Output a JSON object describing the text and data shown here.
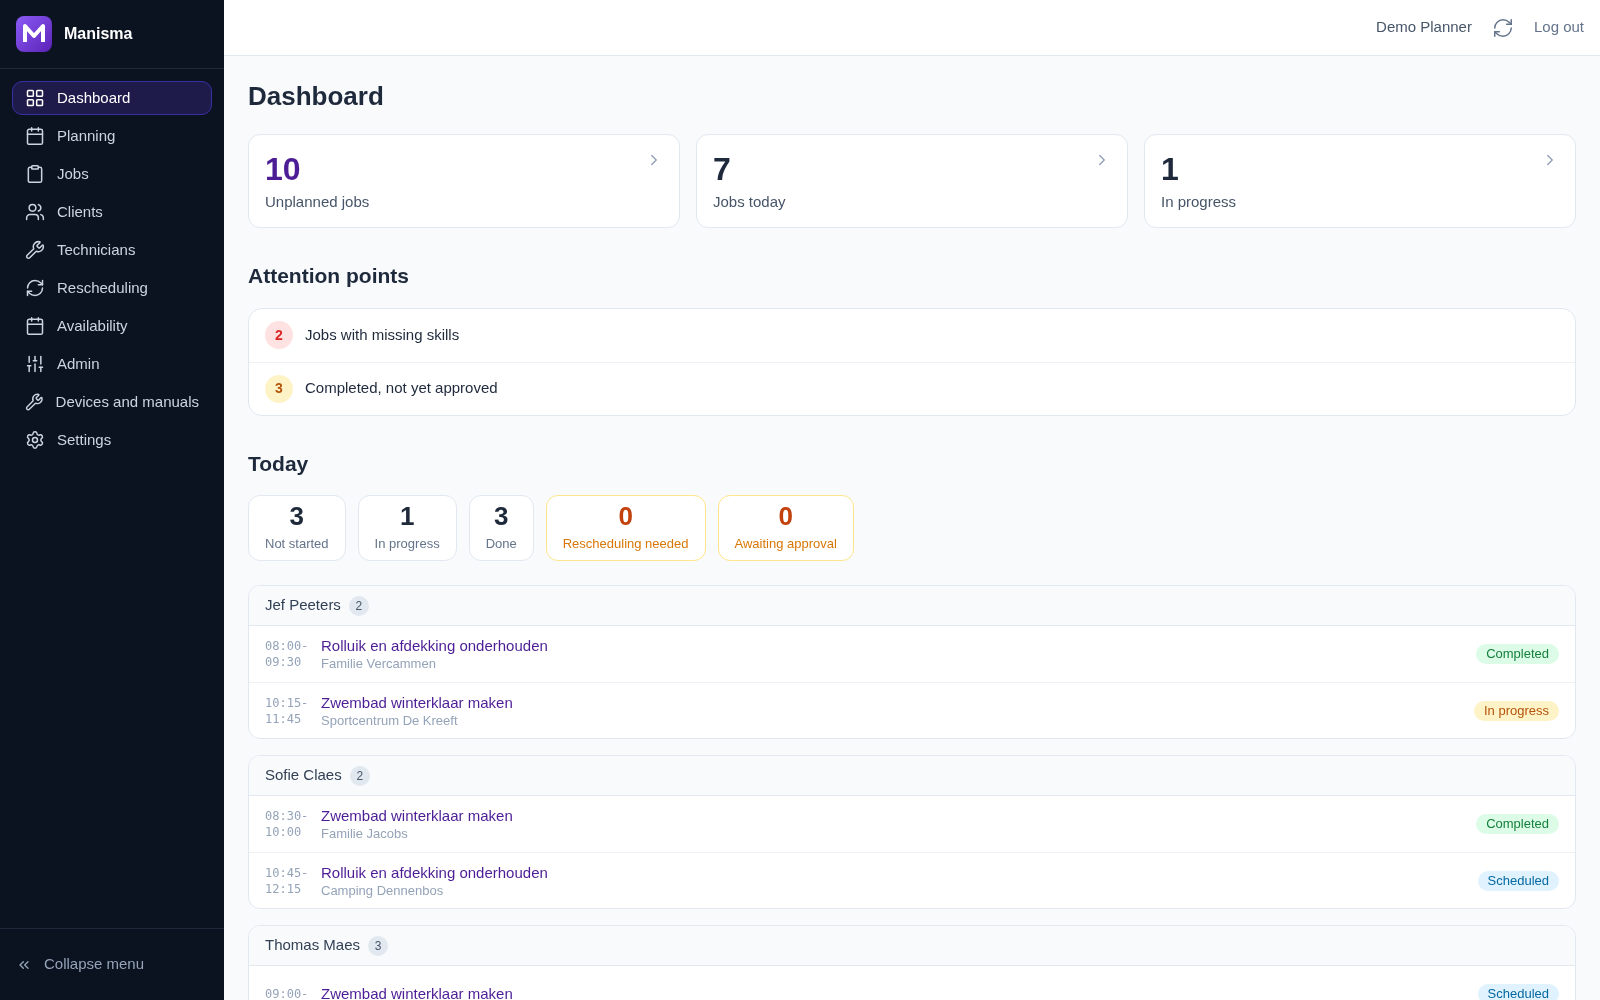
{
  "brand": {
    "name": "Manisma"
  },
  "sidebar": {
    "items": [
      {
        "label": "Dashboard",
        "selected": true
      },
      {
        "label": "Planning",
        "selected": false
      },
      {
        "label": "Jobs",
        "selected": false
      },
      {
        "label": "Clients",
        "selected": false
      },
      {
        "label": "Technicians",
        "selected": false
      },
      {
        "label": "Rescheduling",
        "selected": false
      },
      {
        "label": "Availability",
        "selected": false
      },
      {
        "label": "Admin",
        "selected": false
      },
      {
        "label": "Devices and manuals",
        "selected": false
      },
      {
        "label": "Settings",
        "selected": false
      }
    ],
    "collapse": "Collapse menu"
  },
  "topbar": {
    "user": "Demo Planner",
    "logout": "Log out"
  },
  "title": "Dashboard",
  "summary_cards": [
    {
      "value": "10",
      "label": "Unplanned jobs",
      "accent": true
    },
    {
      "value": "7",
      "label": "Jobs today",
      "accent": false
    },
    {
      "value": "1",
      "label": "In progress",
      "accent": false
    }
  ],
  "attention": {
    "title": "Attention points",
    "items": [
      {
        "count": "2",
        "label": "Jobs with missing skills",
        "kind": "danger"
      },
      {
        "count": "3",
        "label": "Completed, not yet approved",
        "kind": "warning"
      }
    ]
  },
  "today": {
    "title": "Today",
    "stats": [
      {
        "value": "3",
        "label": "Not started",
        "kind": "neutral"
      },
      {
        "value": "1",
        "label": "In progress",
        "kind": "neutral"
      },
      {
        "value": "3",
        "label": "Done",
        "kind": "neutral"
      },
      {
        "value": "0",
        "label": "Rescheduling needed",
        "kind": "warning"
      },
      {
        "value": "0",
        "label": "Awaiting approval",
        "kind": "warning"
      }
    ]
  },
  "technicians": [
    {
      "name": "Jef Peeters",
      "count": "2",
      "jobs": [
        {
          "start": "08:00-",
          "end": "09:30",
          "title": "Rolluik en afdekking onderhouden",
          "client": "Familie Vercammen",
          "status": "Completed",
          "kind": "completed"
        },
        {
          "start": "10:15-",
          "end": "11:45",
          "title": "Zwembad winterklaar maken",
          "client": "Sportcentrum De Kreeft",
          "status": "In progress",
          "kind": "in_progress"
        }
      ]
    },
    {
      "name": "Sofie Claes",
      "count": "2",
      "jobs": [
        {
          "start": "08:30-",
          "end": "10:00",
          "title": "Zwembad winterklaar maken",
          "client": "Familie Jacobs",
          "status": "Completed",
          "kind": "completed"
        },
        {
          "start": "10:45-",
          "end": "12:15",
          "title": "Rolluik en afdekking onderhouden",
          "client": "Camping Dennenbos",
          "status": "Scheduled",
          "kind": "scheduled"
        }
      ]
    },
    {
      "name": "Thomas Maes",
      "count": "3",
      "jobs": [
        {
          "start": "09:00-",
          "title": "Zwembad winterklaar maken",
          "status": "Scheduled",
          "kind": "scheduled"
        }
      ]
    }
  ]
}
